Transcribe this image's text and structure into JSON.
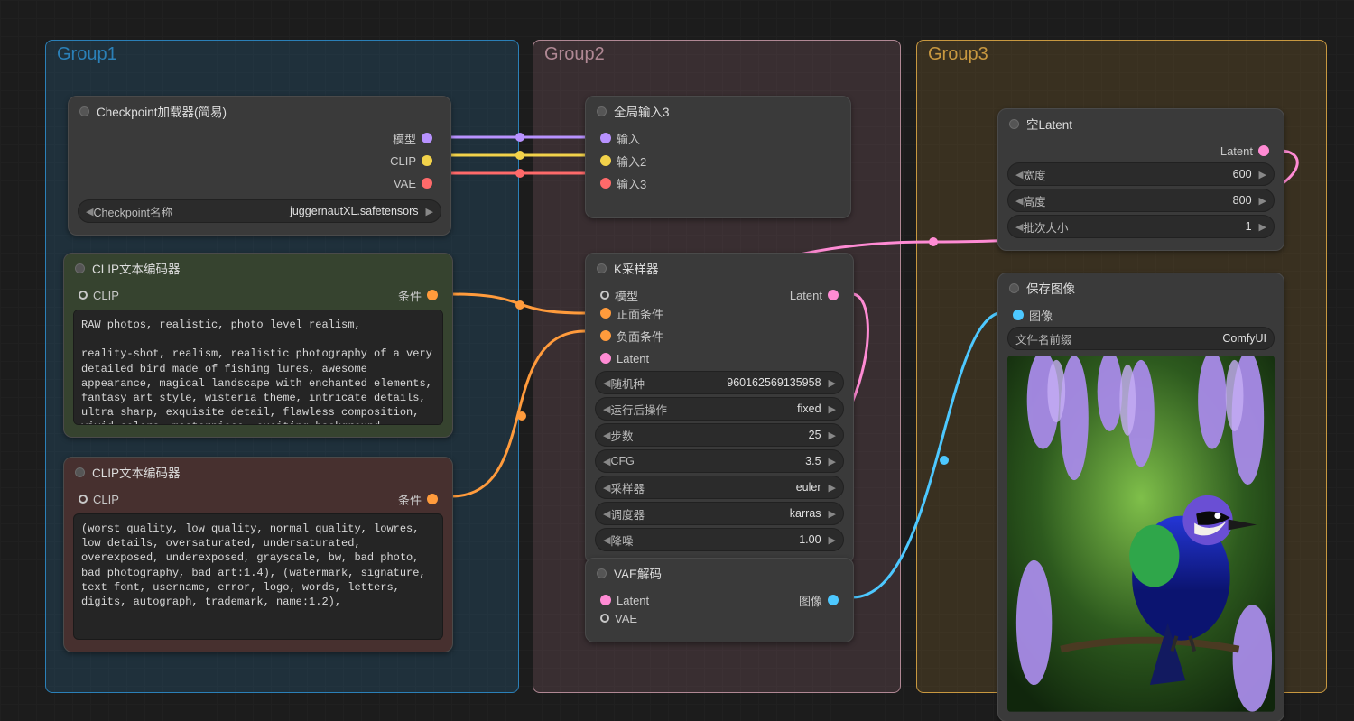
{
  "groups": {
    "g1": {
      "title": "Group1"
    },
    "g2": {
      "title": "Group2"
    },
    "g3": {
      "title": "Group3"
    }
  },
  "checkpoint": {
    "title": "Checkpoint加载器(简易)",
    "outputs": {
      "model": "模型",
      "clip": "CLIP",
      "vae": "VAE"
    },
    "widget_label": "Checkpoint名称",
    "widget_value": "juggernautXL.safetensors"
  },
  "clip_pos": {
    "title": "CLIP文本编码器",
    "in_clip": "CLIP",
    "out_cond": "条件",
    "prompt": "RAW photos, realistic, photo level realism,\n\nreality-shot, realism, realistic photography of a very detailed bird made of fishing lures, awesome appearance, magical landscape with enchanted elements, fantasy art style, wisteria theme, intricate details, ultra sharp, exquisite detail, flawless composition, vivid colors, masterpiece, exciting background"
  },
  "clip_neg": {
    "title": "CLIP文本编码器",
    "in_clip": "CLIP",
    "out_cond": "条件",
    "prompt": "(worst quality, low quality, normal quality, lowres, low details, oversaturated, undersaturated, overexposed, underexposed, grayscale, bw, bad photo, bad photography, bad art:1.4), (watermark, signature, text font, username, error, logo, words, letters, digits, autograph, trademark, name:1.2),"
  },
  "global_in": {
    "title": "全局输入3",
    "in1": "输入",
    "in2": "输入2",
    "in3": "输入3"
  },
  "ksampler": {
    "title": "K采样器",
    "in_model": "模型",
    "in_pos": "正面条件",
    "in_neg": "负面条件",
    "in_latent": "Latent",
    "out_latent": "Latent",
    "rows": [
      {
        "label": "随机种",
        "value": "960162569135958"
      },
      {
        "label": "运行后操作",
        "value": "fixed"
      },
      {
        "label": "步数",
        "value": "25"
      },
      {
        "label": "CFG",
        "value": "3.5"
      },
      {
        "label": "采样器",
        "value": "euler"
      },
      {
        "label": "调度器",
        "value": "karras"
      },
      {
        "label": "降噪",
        "value": "1.00"
      }
    ]
  },
  "vae_decode": {
    "title": "VAE解码",
    "in_latent": "Latent",
    "in_vae": "VAE",
    "out_image": "图像"
  },
  "empty_latent": {
    "title": "空Latent",
    "out_latent": "Latent",
    "rows": [
      {
        "label": "宽度",
        "value": "600"
      },
      {
        "label": "高度",
        "value": "800"
      },
      {
        "label": "批次大小",
        "value": "1"
      }
    ]
  },
  "save_image": {
    "title": "保存图像",
    "in_image": "图像",
    "prefix_label": "文件名前缀",
    "prefix_value": "ComfyUI"
  },
  "colors": {
    "model": "#b892ff",
    "clip": "#f2d24a",
    "vae": "#ff6a6a",
    "cond": "#ff9b3c",
    "latent": "#ff8bd4",
    "image": "#4dc8ff"
  }
}
